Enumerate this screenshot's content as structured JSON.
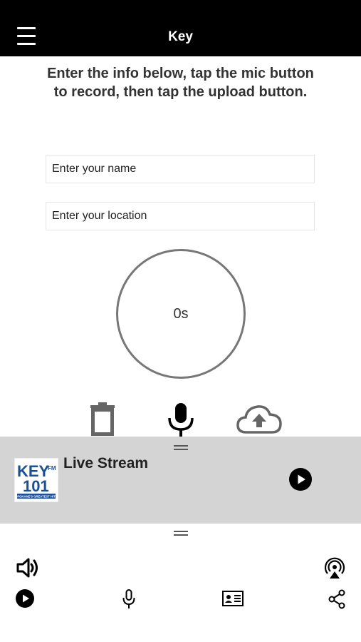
{
  "header": {
    "title": "Key",
    "menu_icon": "menu-icon"
  },
  "recorder": {
    "instructions": "Enter the info below, tap the mic button to record, then tap the upload button.",
    "name_placeholder": "Enter your name",
    "location_placeholder": "Enter your location",
    "timer": "0s",
    "controls": [
      "trash-icon",
      "microphone-icon",
      "cloud-upload-icon"
    ]
  },
  "player": {
    "title": "Live Stream",
    "logo": {
      "main": "KEY",
      "fm": "FM",
      "number": "101",
      "tagline": "SPOKANE'S GREATEST HITS"
    },
    "play_icon": "play-icon"
  },
  "bottom_bar": {
    "icons": [
      "volume-icon",
      "airplay-icon",
      "play-icon",
      "microphone-icon",
      "contact-card-icon",
      "share-icon"
    ]
  },
  "colors": {
    "header_bg": "#000000",
    "player_bg": "#d4d4d4",
    "logo_blue": "#1a4fa0"
  }
}
